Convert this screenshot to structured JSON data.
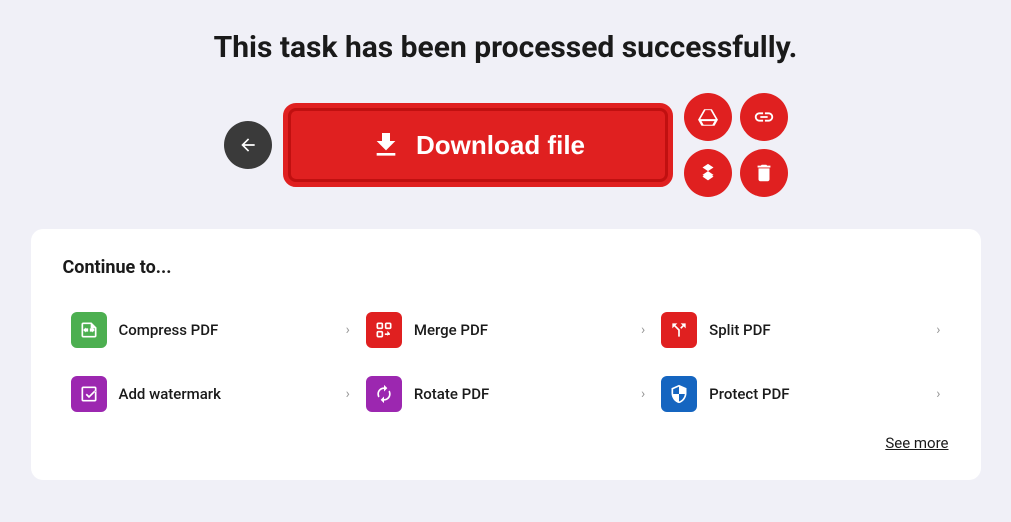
{
  "page": {
    "title": "This task has been processed successfully.",
    "background_color": "#f0f0f7"
  },
  "actions": {
    "back_label": "back",
    "download_label": "Download file",
    "drive_label": "Save to Google Drive",
    "link_label": "Copy link",
    "dropbox_label": "Save to Dropbox",
    "delete_label": "Delete file"
  },
  "continue_section": {
    "title": "Continue to...",
    "see_more_label": "See more",
    "tools": [
      {
        "id": "compress-pdf",
        "label": "Compress PDF",
        "icon_type": "compress",
        "icon_symbol": "⚙"
      },
      {
        "id": "merge-pdf",
        "label": "Merge PDF",
        "icon_type": "merge",
        "icon_symbol": "⇄"
      },
      {
        "id": "split-pdf",
        "label": "Split PDF",
        "icon_type": "split",
        "icon_symbol": "✂"
      },
      {
        "id": "add-watermark",
        "label": "Add watermark",
        "icon_type": "watermark",
        "icon_symbol": "W"
      },
      {
        "id": "rotate-pdf",
        "label": "Rotate PDF",
        "icon_type": "rotate",
        "icon_symbol": "↻"
      },
      {
        "id": "protect-pdf",
        "label": "Protect PDF",
        "icon_type": "protect",
        "icon_symbol": "🛡"
      }
    ]
  }
}
